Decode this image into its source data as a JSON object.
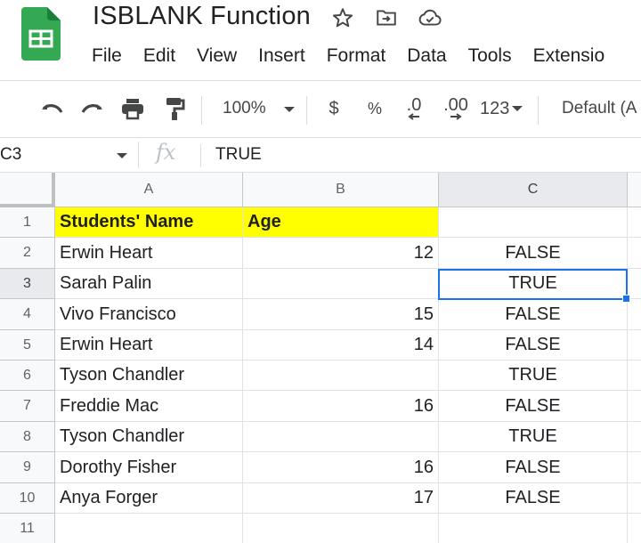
{
  "app": {
    "doc_title": "ISBLANK Function",
    "title_icons": [
      "star-icon",
      "move-to-folder-icon",
      "cloud-saved-icon"
    ],
    "brand_color": "#34a853"
  },
  "menu": [
    "File",
    "Edit",
    "View",
    "Insert",
    "Format",
    "Data",
    "Tools",
    "Extensio"
  ],
  "toolbar": {
    "zoom": "100%",
    "currency": "$",
    "percent": "%",
    "decrease_decimal": ".0",
    "increase_decimal": ".00",
    "more_formats": "123",
    "font": "Default (A"
  },
  "formula_bar": {
    "cell_ref": "C3",
    "fx_label": "fx",
    "value": "TRUE"
  },
  "grid": {
    "columns": [
      "A",
      "B",
      "C"
    ],
    "selected_column": "C",
    "selected_row": "3",
    "selection_color": "#1a73e8",
    "header_fill": "#ffff00",
    "rows": [
      {
        "num": "1",
        "a": "Students' Name",
        "b": "Age",
        "c": ""
      },
      {
        "num": "2",
        "a": "Erwin Heart",
        "b": "12",
        "c": "FALSE"
      },
      {
        "num": "3",
        "a": "Sarah Palin",
        "b": "",
        "c": "TRUE"
      },
      {
        "num": "4",
        "a": "Vivo Francisco",
        "b": "15",
        "c": "FALSE"
      },
      {
        "num": "5",
        "a": "Erwin Heart",
        "b": "14",
        "c": "FALSE"
      },
      {
        "num": "6",
        "a": "Tyson Chandler",
        "b": "",
        "c": "TRUE"
      },
      {
        "num": "7",
        "a": "Freddie Mac",
        "b": "16",
        "c": "FALSE"
      },
      {
        "num": "8",
        "a": "Tyson Chandler",
        "b": "",
        "c": "TRUE"
      },
      {
        "num": "9",
        "a": "Dorothy Fisher",
        "b": "16",
        "c": "FALSE"
      },
      {
        "num": "10",
        "a": "Anya Forger",
        "b": "17",
        "c": "FALSE"
      },
      {
        "num": "11",
        "a": "",
        "b": "",
        "c": ""
      }
    ]
  }
}
